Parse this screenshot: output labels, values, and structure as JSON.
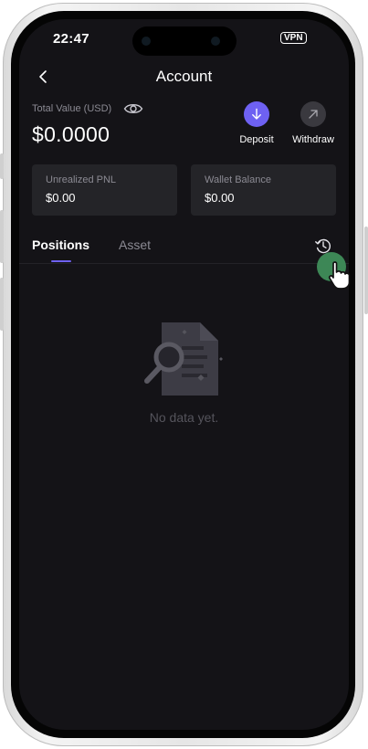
{
  "status_bar": {
    "time": "22:47",
    "vpn": "VPN"
  },
  "header": {
    "title": "Account"
  },
  "summary": {
    "total_value_label": "Total Value (USD)",
    "total_value": "$0.0000",
    "deposit_label": "Deposit",
    "withdraw_label": "Withdraw"
  },
  "cards": {
    "unrealized_label": "Unrealized PNL",
    "unrealized_value": "$0.00",
    "wallet_label": "Wallet Balance",
    "wallet_value": "$0.00"
  },
  "tabs": {
    "items": [
      {
        "label": "Positions",
        "active": true
      },
      {
        "label": "Asset",
        "active": false
      }
    ]
  },
  "empty_state": {
    "text": "No data yet."
  },
  "colors": {
    "background": "#141317",
    "card": "#242428",
    "accent": "#6e61f2",
    "muted": "#8b8a93"
  },
  "icons": [
    "back-arrow-icon",
    "eye-icon",
    "arrow-down-icon",
    "arrow-up-right-icon",
    "history-icon",
    "document-search-icon",
    "hand-pointer-icon"
  ]
}
